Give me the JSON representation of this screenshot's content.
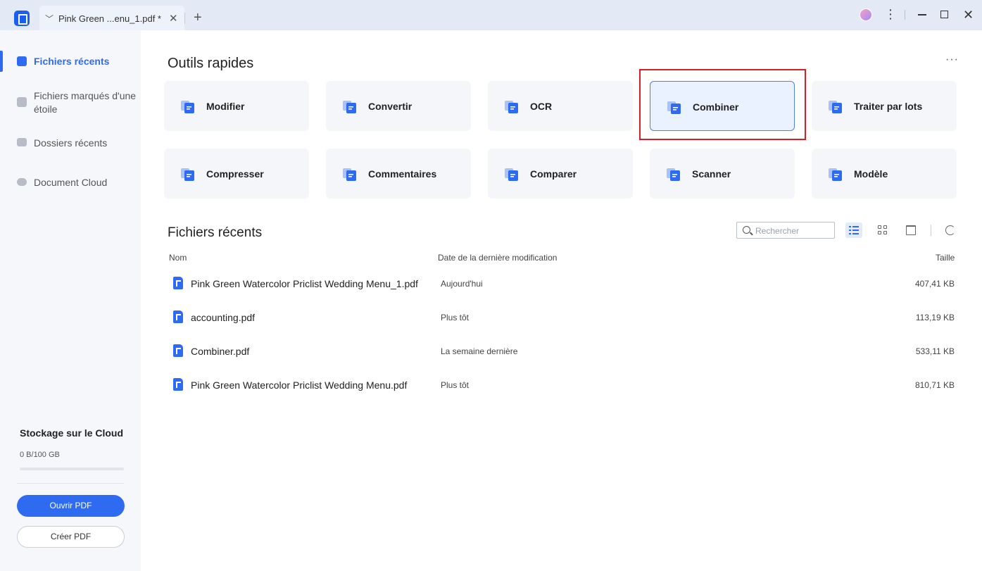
{
  "titlebar": {
    "tab_label": "Pink Green ...enu_1.pdf *",
    "tab_chevron": "﹀",
    "tab_close": "✕",
    "new_tab": "+",
    "kebab": "⋮",
    "win_close": "✕"
  },
  "sidebar": {
    "items": [
      {
        "label": "Fichiers récents",
        "active": true
      },
      {
        "label": "Fichiers marqués d'une étoile",
        "active": false
      },
      {
        "label": "Dossiers récents",
        "active": false
      },
      {
        "label": "Document Cloud",
        "active": false
      }
    ],
    "storage": {
      "title": "Stockage sur le Cloud",
      "value": "0 B/100 GB",
      "used_fraction": 0
    },
    "open_pdf": "Ouvrir PDF",
    "create_pdf": "Créer PDF"
  },
  "tools": {
    "title": "Outils rapides",
    "more": "···",
    "items": [
      {
        "label": "Modifier",
        "icon": "edit-icon"
      },
      {
        "label": "Convertir",
        "icon": "convert-icon"
      },
      {
        "label": "OCR",
        "icon": "ocr-icon"
      },
      {
        "label": "Combiner",
        "icon": "combine-icon",
        "selected": true
      },
      {
        "label": "Traiter par lots",
        "icon": "batch-icon"
      },
      {
        "label": "Compresser",
        "icon": "compress-icon"
      },
      {
        "label": "Commentaires",
        "icon": "comment-icon"
      },
      {
        "label": "Comparer",
        "icon": "compare-icon"
      },
      {
        "label": "Scanner",
        "icon": "scanner-icon"
      },
      {
        "label": "Modèle",
        "icon": "template-icon"
      }
    ]
  },
  "recent": {
    "title": "Fichiers récents",
    "search_placeholder": "Rechercher",
    "columns": {
      "name": "Nom",
      "date": "Date de la dernière modification",
      "size": "Taille"
    },
    "files": [
      {
        "name": "Pink Green Watercolor Priclist Wedding Menu_1.pdf",
        "date": "Aujourd'hui",
        "size": "407,41 KB"
      },
      {
        "name": "accounting.pdf",
        "date": "Plus tôt",
        "size": "113,19 KB"
      },
      {
        "name": "Combiner.pdf",
        "date": "La semaine dernière",
        "size": "533,11 KB"
      },
      {
        "name": "Pink Green Watercolor Priclist Wedding Menu.pdf",
        "date": "Plus tôt",
        "size": "810,71 KB"
      }
    ]
  },
  "colors": {
    "accent": "#2f6bf0",
    "highlight": "#d71e28",
    "sidebar_bg": "#f6f7fa",
    "titlebar_bg": "#e3eaf6"
  }
}
